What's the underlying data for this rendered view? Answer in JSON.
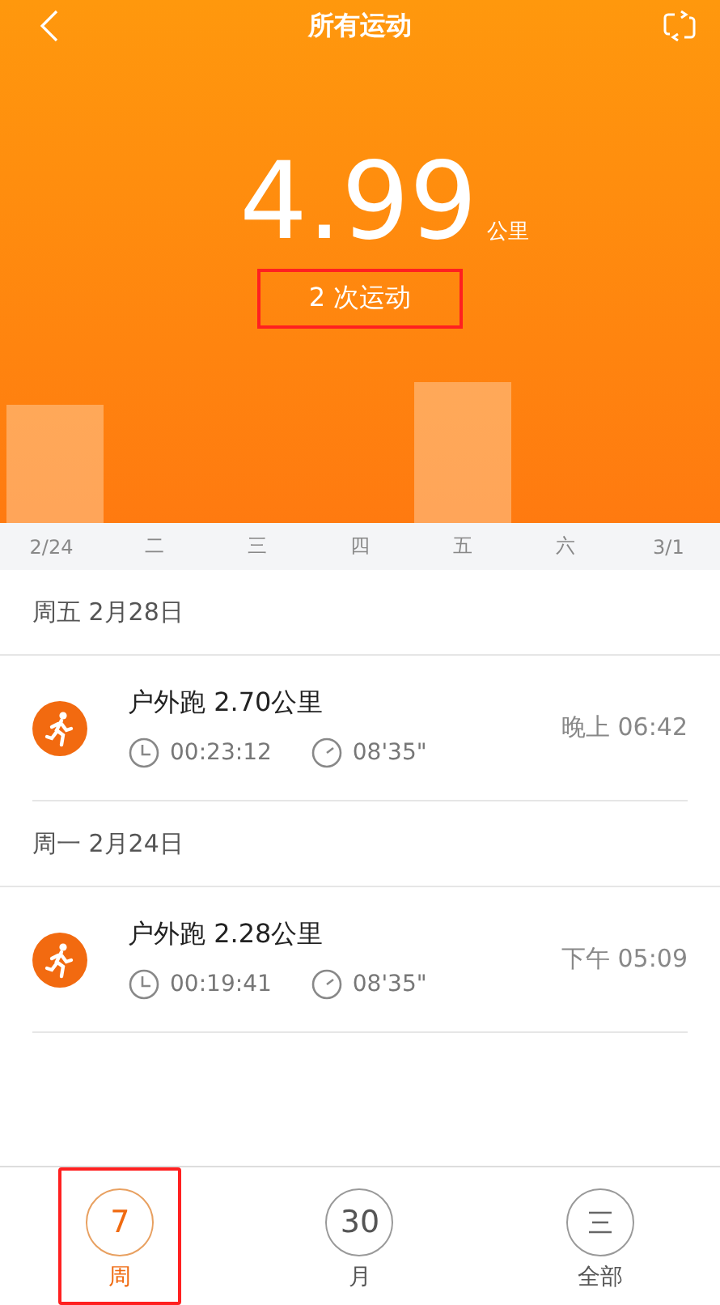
{
  "header": {
    "title": "所有运动"
  },
  "summary": {
    "distance": "4.99",
    "unit": "公里",
    "count": "2 次运动",
    "highlighted": true
  },
  "days": [
    "2/24",
    "二",
    "三",
    "四",
    "五",
    "六",
    "3/1"
  ],
  "groups": [
    {
      "date": "周五 2月28日",
      "items": [
        {
          "title": "户外跑 2.70公里",
          "duration": "00:23:12",
          "pace": "08'35\"",
          "time": "晚上 06:42"
        }
      ]
    },
    {
      "date": "周一 2月24日",
      "items": [
        {
          "title": "户外跑 2.28公里",
          "duration": "00:19:41",
          "pace": "08'35\"",
          "time": "下午 05:09"
        }
      ]
    }
  ],
  "tabs": [
    {
      "kind": "number",
      "icon_text": "7",
      "label": "周",
      "selected": true,
      "highlighted": true
    },
    {
      "kind": "number",
      "icon_text": "30",
      "label": "月",
      "selected": false,
      "highlighted": false
    },
    {
      "kind": "menu",
      "label": "全部",
      "selected": false,
      "highlighted": false
    }
  ]
}
